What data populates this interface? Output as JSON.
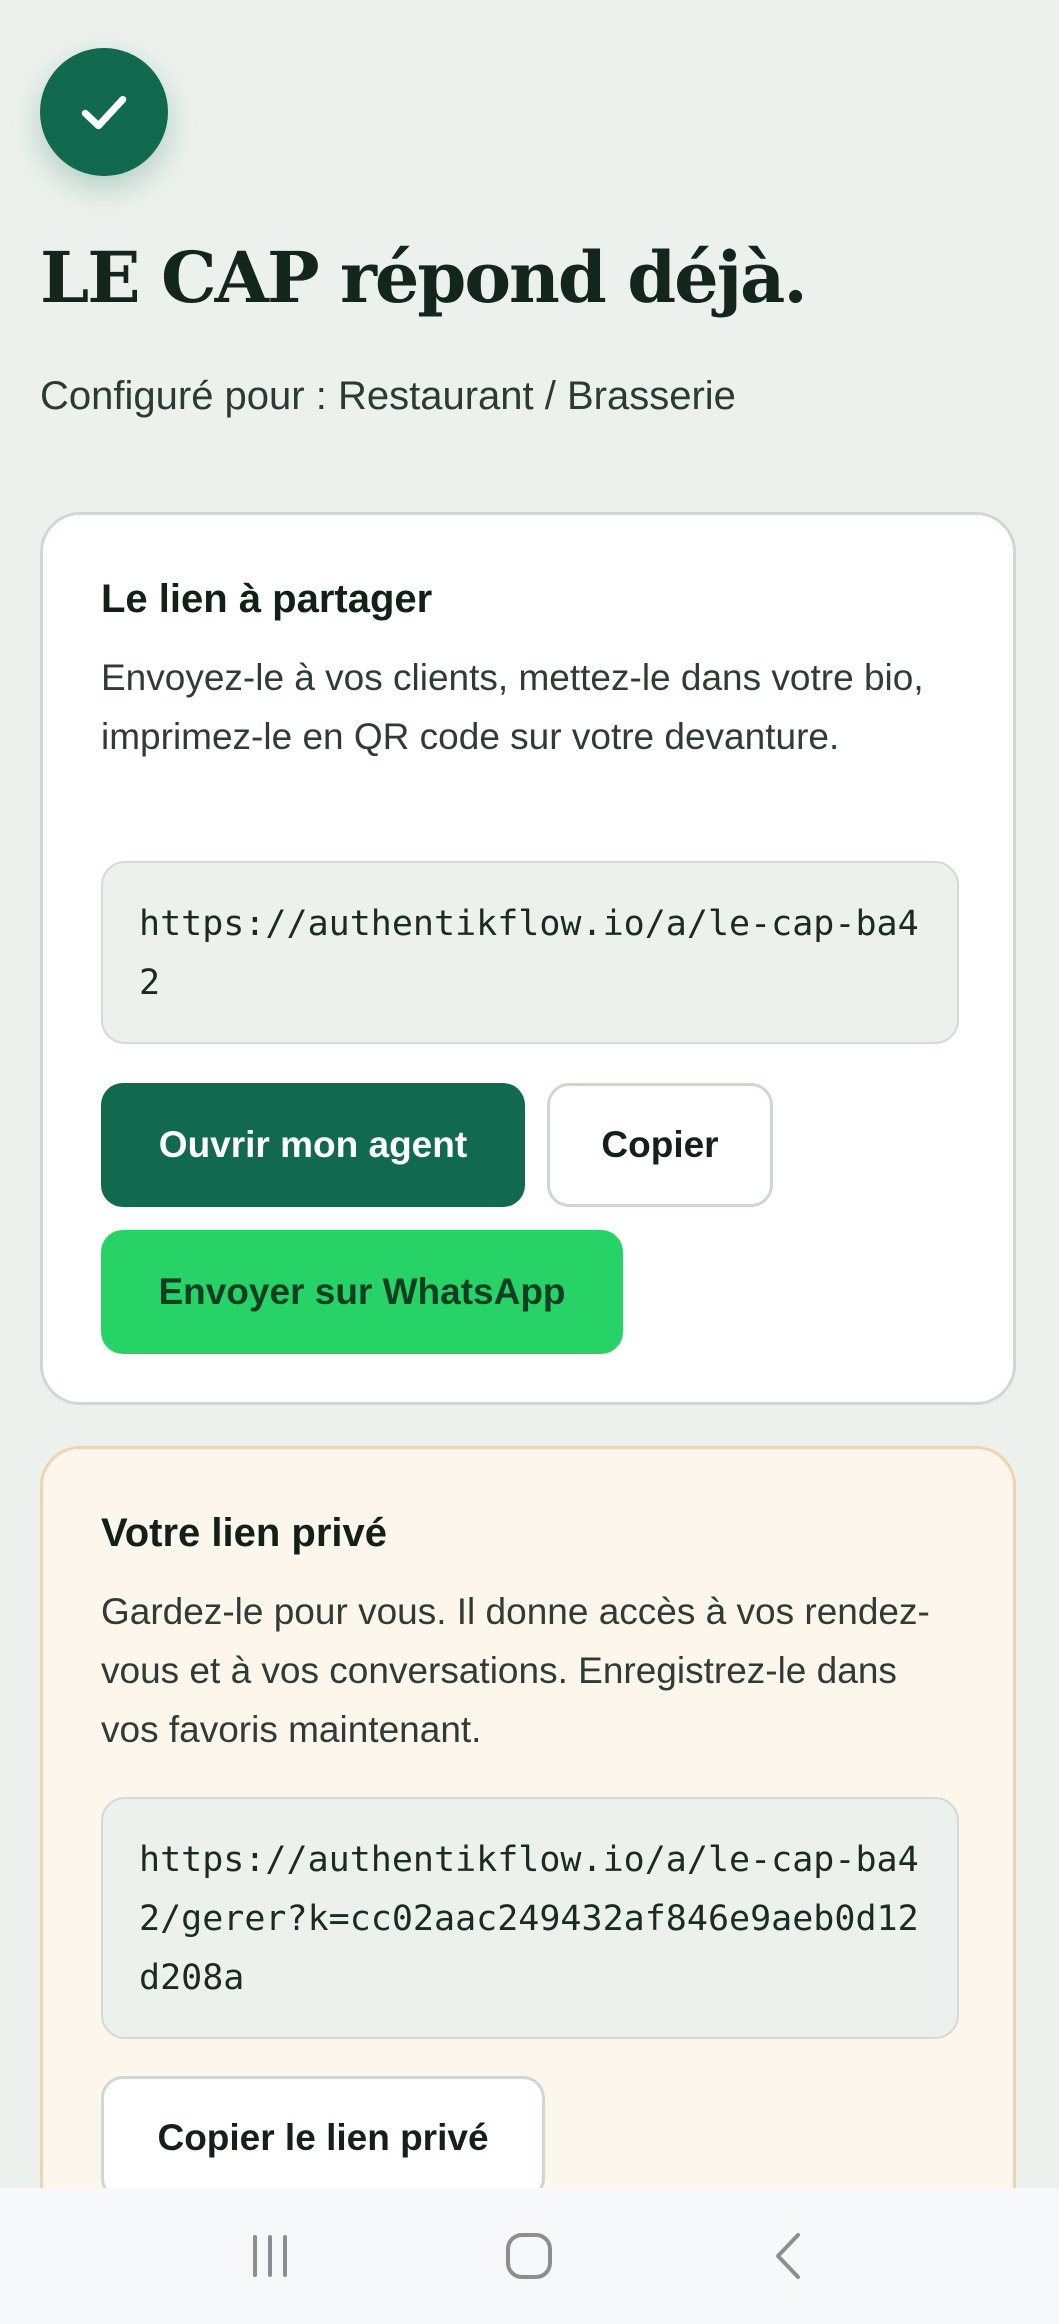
{
  "header": {
    "title": "LE CAP répond déjà.",
    "subtitle": "Configuré pour : Restaurant / Brasserie"
  },
  "share_card": {
    "title": "Le lien à partager",
    "description": "Envoyez-le à vos clients, mettez-le dans votre bio, imprimez-le en QR code sur votre devanture.",
    "link": "https://authentikflow.io/a/le-cap-ba42",
    "open_button": "Ouvrir mon agent",
    "copy_button": "Copier",
    "whatsapp_button": "Envoyer sur WhatsApp"
  },
  "private_card": {
    "title": "Votre lien privé",
    "description": "Gardez-le pour vous. Il donne accès à vos rendez-vous et à vos conversations. Enregistrez-le dans vos favoris maintenant.",
    "link": "https://authentikflow.io/a/le-cap-ba42/gerer?k=cc02aac249432af846e9aeb0d12d208a",
    "copy_button": "Copier le lien privé"
  },
  "colors": {
    "primary": "#116a50",
    "whatsapp": "#27d366",
    "background": "#ecf1ed",
    "private_card_bg": "#fdf6ec"
  },
  "icons": {
    "badge": "check-icon",
    "nav": [
      "recent-apps-icon",
      "home-icon",
      "back-icon"
    ]
  }
}
